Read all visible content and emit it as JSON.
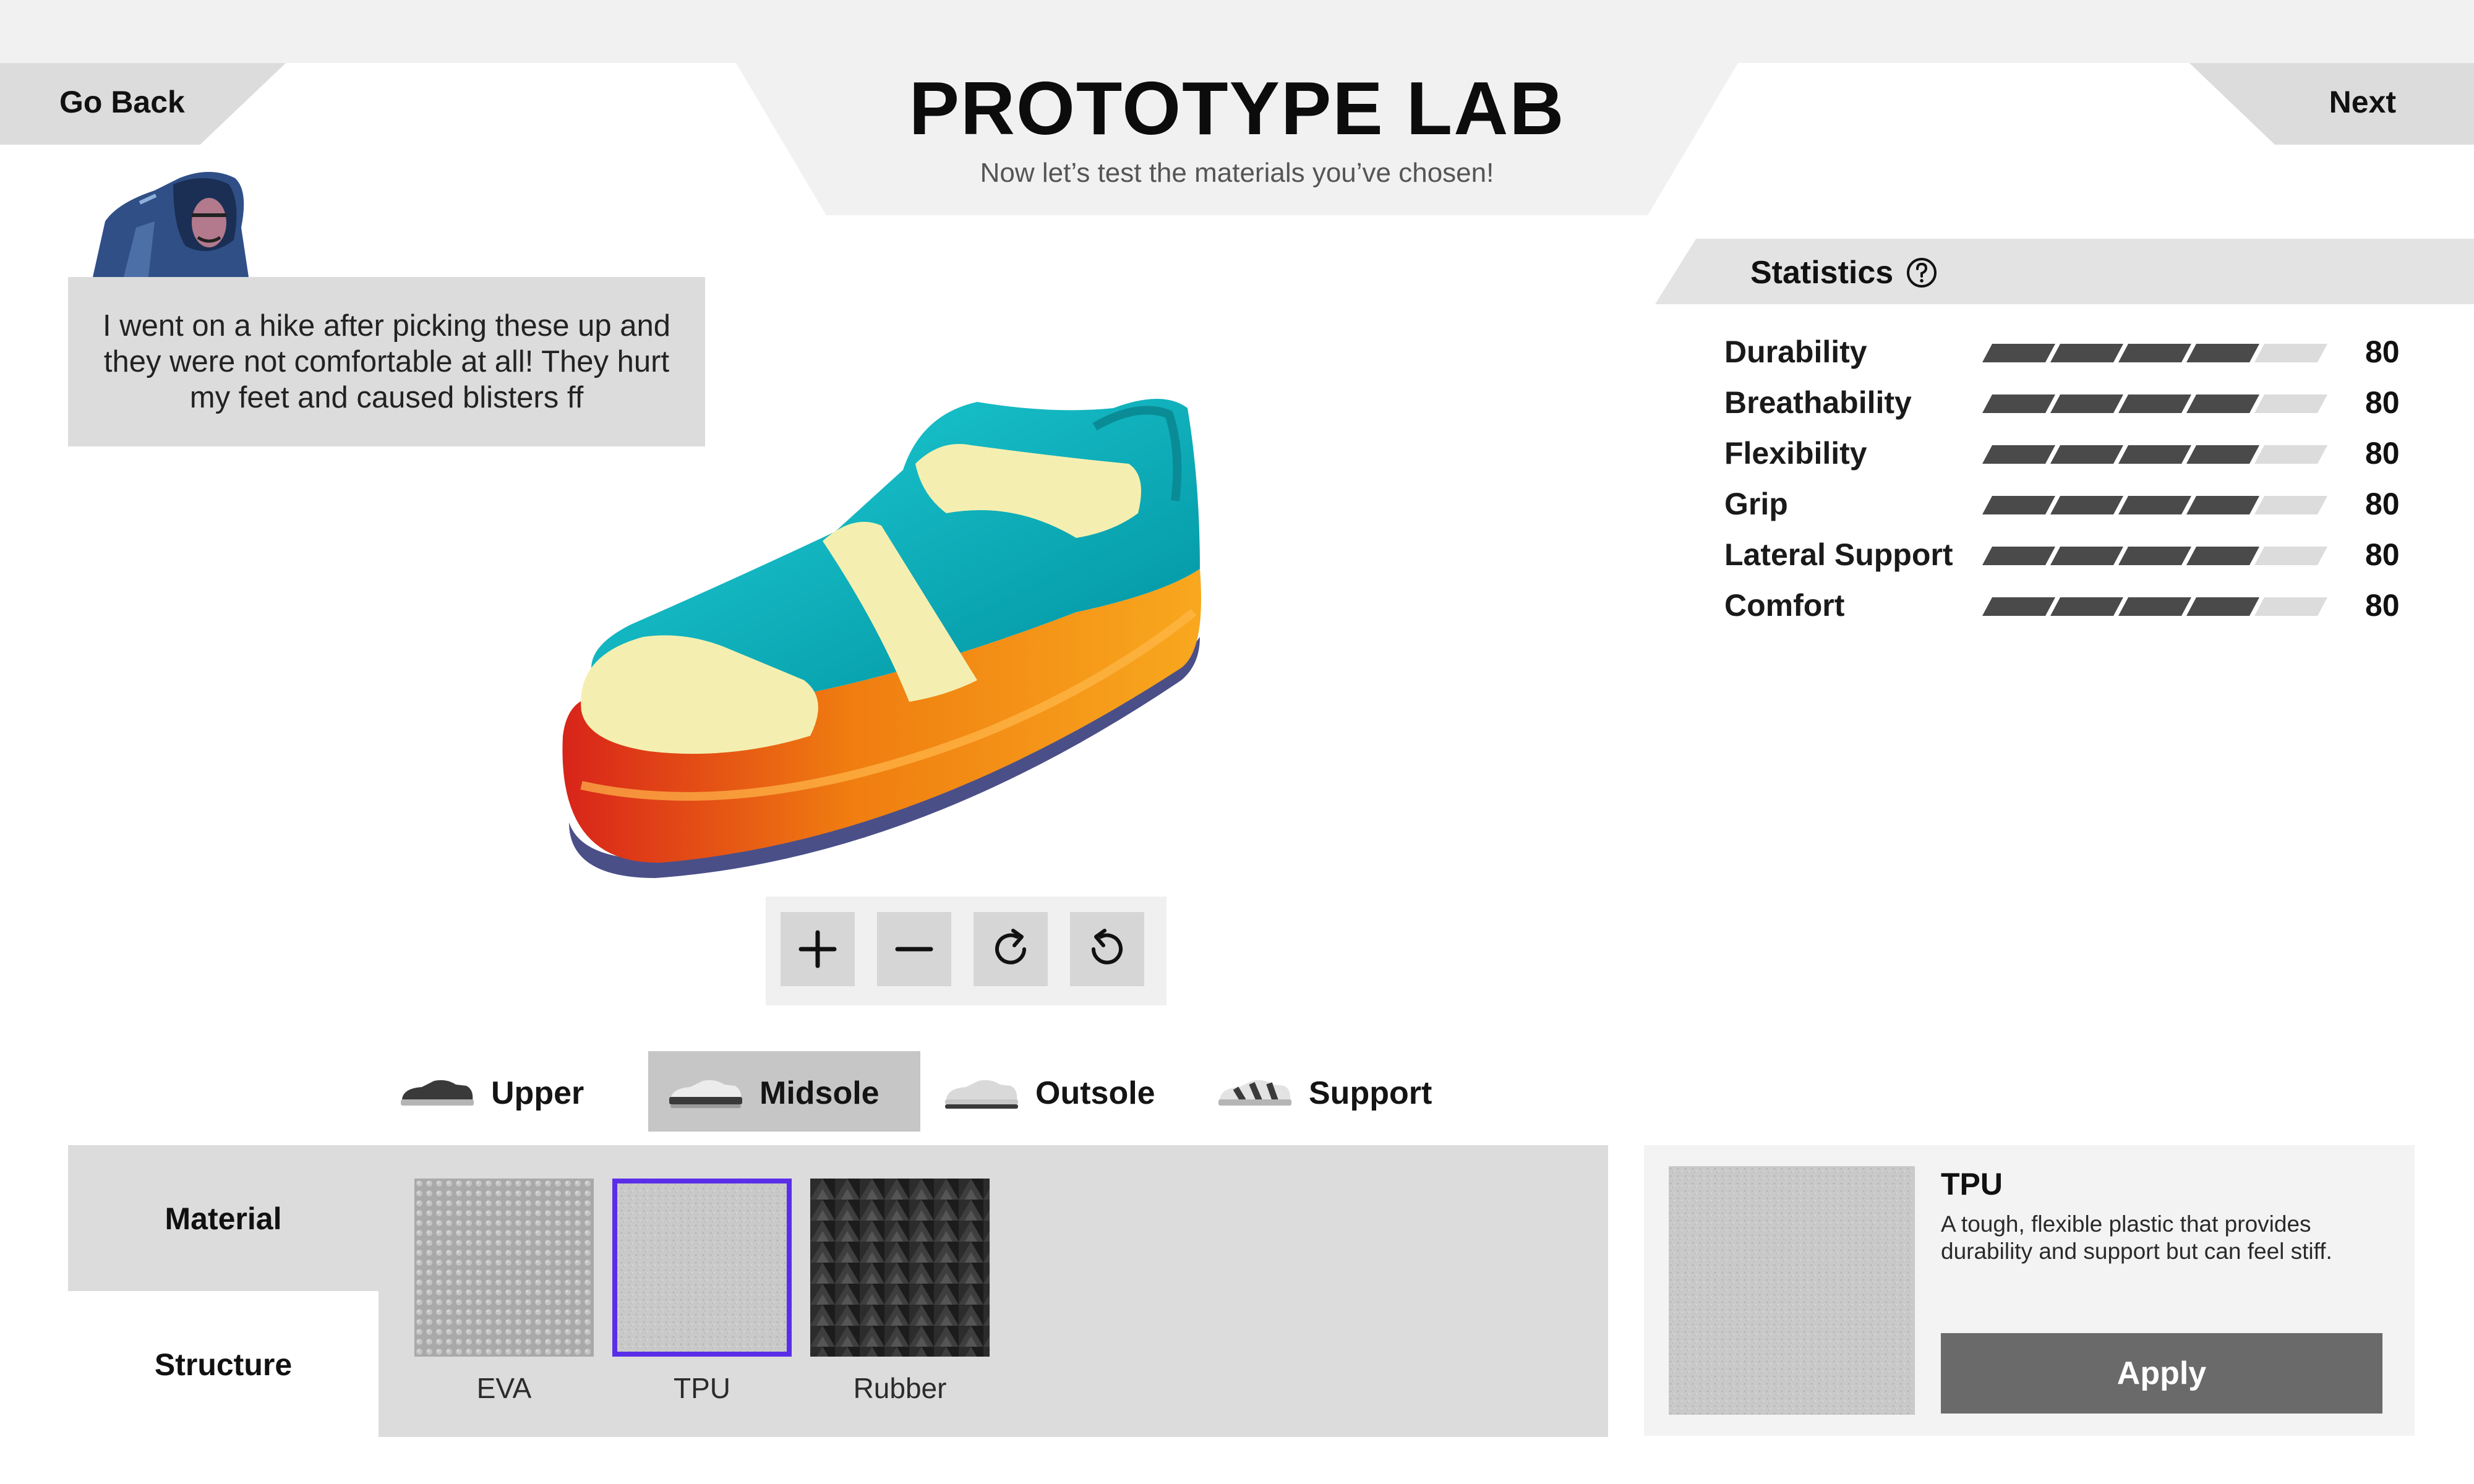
{
  "header": {
    "title": "PROTOTYPE LAB",
    "subtitle": "Now let’s test the materials you’ve chosen!",
    "back_label": "Go Back",
    "next_label": "Next"
  },
  "customer": {
    "message": "I went on a hike after picking these up and they were not comfortable at all! They hurt my feet and caused blisters ff"
  },
  "viewer_controls": [
    {
      "name": "zoom-in-icon"
    },
    {
      "name": "zoom-out-icon"
    },
    {
      "name": "rotate-clockwise-icon"
    },
    {
      "name": "rotate-counterclockwise-icon"
    }
  ],
  "statistics": {
    "title": "Statistics",
    "help_icon": "question-circle-icon",
    "max_value": 100,
    "items": [
      {
        "label": "Durability",
        "value": 80
      },
      {
        "label": "Breathability",
        "value": 80
      },
      {
        "label": "Flexibility",
        "value": 80
      },
      {
        "label": "Grip",
        "value": 80
      },
      {
        "label": "Lateral Support",
        "value": 80
      },
      {
        "label": "Comfort",
        "value": 80
      }
    ]
  },
  "parts": {
    "active": "Midsole",
    "tabs": [
      {
        "label": "Upper",
        "icon": "upper-shoe-icon"
      },
      {
        "label": "Midsole",
        "icon": "midsole-shoe-icon"
      },
      {
        "label": "Outsole",
        "icon": "outsole-shoe-icon"
      },
      {
        "label": "Support",
        "icon": "support-shoe-icon"
      }
    ]
  },
  "side_tabs": {
    "active": "Material",
    "items": [
      {
        "label": "Material"
      },
      {
        "label": "Structure"
      }
    ]
  },
  "materials": {
    "selected": "TPU",
    "items": [
      {
        "label": "EVA"
      },
      {
        "label": "TPU"
      },
      {
        "label": "Rubber"
      }
    ]
  },
  "details": {
    "name": "TPU",
    "description": "A tough, flexible plastic that provides durability and support but can feel stiff.",
    "apply_label": "Apply"
  },
  "colors": {
    "accent_selection": "#5a2ee8",
    "shoe_upper": "#00b2c0",
    "shoe_trim": "#f4efb0",
    "shoe_midsole": "#f39a14",
    "apply_button": "#6a6a6a"
  }
}
